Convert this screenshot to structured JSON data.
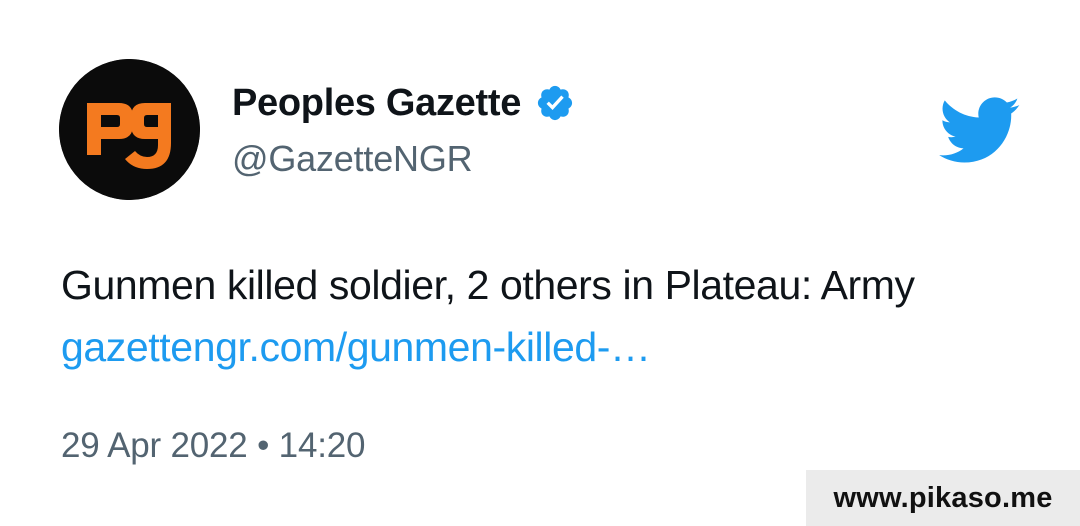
{
  "author": {
    "display_name": "Peoples Gazette",
    "handle": "@GazetteNGR",
    "verified": true,
    "avatar_icon": "pg-logo",
    "avatar_colors": {
      "background": "#0b0b0b",
      "logo": "#f47a1f"
    }
  },
  "tweet": {
    "text": "Gunmen killed soldier, 2 others in Plateau: Army",
    "link": "gazettengr.com/gunmen-killed-…",
    "timestamp": "29 Apr 2022 • 14:20"
  },
  "icons": {
    "verified": "verified-badge-icon",
    "platform": "twitter-bird-icon"
  },
  "colors": {
    "link": "#1d9bf0",
    "twitter_blue": "#1d9bf0",
    "secondary_text": "#536471",
    "primary_text": "#0f1419"
  },
  "watermark": {
    "text": "www.pikaso.me"
  }
}
